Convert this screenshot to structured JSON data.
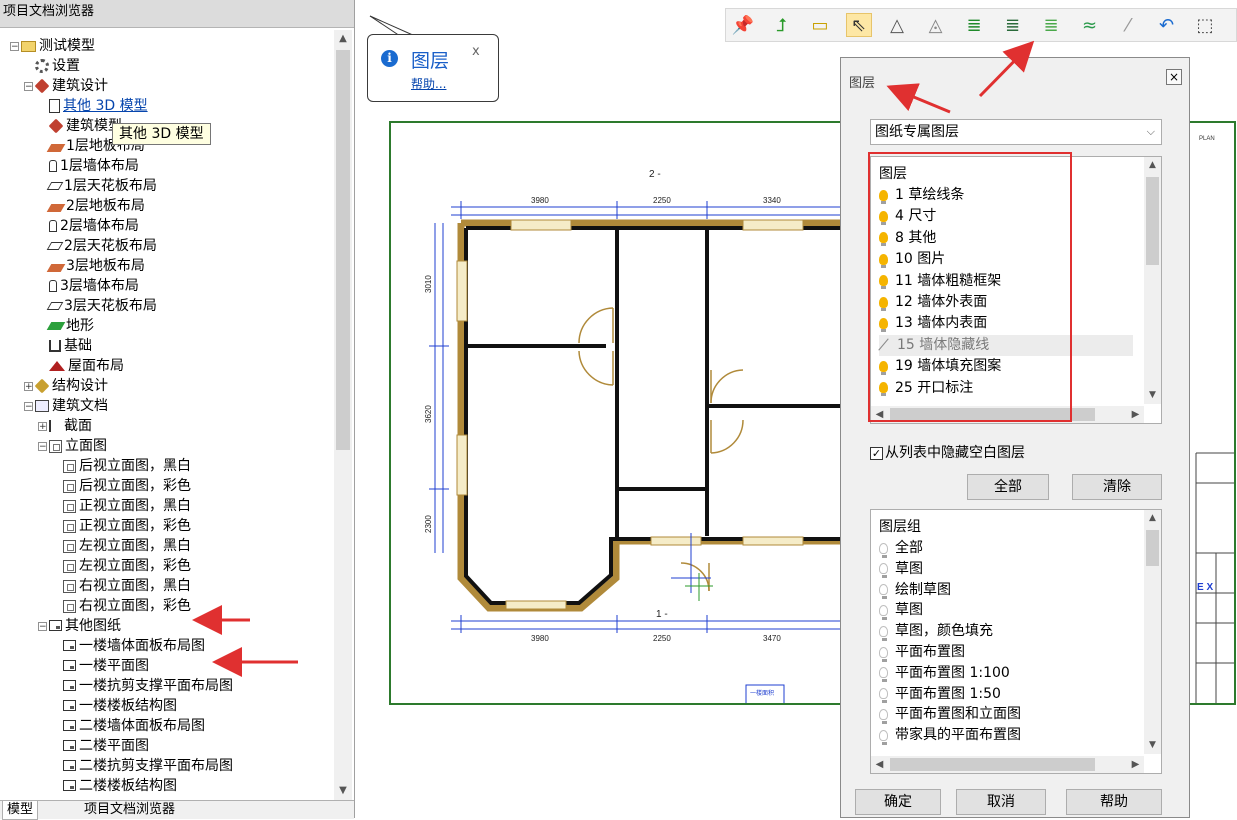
{
  "browser": {
    "title": "项目文档浏览器",
    "tooltip": "其他 3D 模型",
    "tree": [
      {
        "label": "测试模型",
        "icon": "folder-icon",
        "exp": "−"
      },
      {
        "label": "设置",
        "icon": "gear-icon"
      },
      {
        "label": "建筑设计",
        "icon": "architecture-icon",
        "exp": "−"
      },
      {
        "label": "其他 3D 模型",
        "icon": "3d-model-doc-icon",
        "link": true
      },
      {
        "label": "建筑模型",
        "icon": "architecture-model-icon"
      },
      {
        "label": "1层地板布局",
        "icon": "slab-icon"
      },
      {
        "label": "1层墙体布局",
        "icon": "wall-icon"
      },
      {
        "label": "1层天花板布局",
        "icon": "ceiling-icon"
      },
      {
        "label": "2层地板布局",
        "icon": "slab-icon"
      },
      {
        "label": "2层墙体布局",
        "icon": "wall-icon"
      },
      {
        "label": "2层天花板布局",
        "icon": "ceiling-icon"
      },
      {
        "label": "3层地板布局",
        "icon": "slab-icon"
      },
      {
        "label": "3层墙体布局",
        "icon": "wall-icon"
      },
      {
        "label": "3层天花板布局",
        "icon": "ceiling-icon"
      },
      {
        "label": "地形",
        "icon": "terrain-icon"
      },
      {
        "label": "基础",
        "icon": "foundation-icon"
      },
      {
        "label": "屋面布局",
        "icon": "roof-icon"
      },
      {
        "label": "结构设计",
        "icon": "structure-icon",
        "exp": "+"
      },
      {
        "label": "建筑文档",
        "icon": "documents-icon",
        "exp": "−"
      },
      {
        "label": "截面",
        "icon": "section-icon",
        "exp": "+"
      },
      {
        "label": "立面图",
        "icon": "elevation-icon",
        "exp": "−"
      },
      {
        "label": "后视立面图，黑白",
        "icon": "elevation-icon"
      },
      {
        "label": "后视立面图，彩色",
        "icon": "elevation-icon"
      },
      {
        "label": "正视立面图，黑白",
        "icon": "elevation-icon"
      },
      {
        "label": "正视立面图，彩色",
        "icon": "elevation-icon"
      },
      {
        "label": "左视立面图，黑白",
        "icon": "elevation-icon"
      },
      {
        "label": "左视立面图，彩色",
        "icon": "elevation-icon"
      },
      {
        "label": "右视立面图，黑白",
        "icon": "elevation-icon"
      },
      {
        "label": "右视立面图，彩色",
        "icon": "elevation-icon"
      },
      {
        "label": "其他图纸",
        "icon": "sheet-icon",
        "exp": "−"
      },
      {
        "label": "一楼墙体面板布局图",
        "icon": "sheet-icon"
      },
      {
        "label": "一楼平面图",
        "icon": "sheet-icon"
      },
      {
        "label": "一楼抗剪支撑平面布局图",
        "icon": "sheet-icon"
      },
      {
        "label": "一楼楼板结构图",
        "icon": "sheet-icon"
      },
      {
        "label": "二楼墙体面板布局图",
        "icon": "sheet-icon"
      },
      {
        "label": "二楼平面图",
        "icon": "sheet-icon"
      },
      {
        "label": "二楼抗剪支撑平面布局图",
        "icon": "sheet-icon"
      },
      {
        "label": "二楼楼板结构图",
        "icon": "sheet-icon"
      }
    ],
    "tabs": [
      "模型",
      "项目文档浏览器"
    ]
  },
  "toolbar": {
    "tools": [
      "pin-icon",
      "smart-tool-icon",
      "ruler-icon",
      "select-arrow-icon",
      "triangle-icon",
      "dashed-triangle-icon",
      "layers-green-icon",
      "layers-dark-icon",
      "layers-stack-icon",
      "layers-thin-icon",
      "line-icon",
      "undo-arrow-icon",
      "frame-icon"
    ],
    "selected_index": 3
  },
  "helpbox": {
    "title": "图层",
    "close": "x",
    "help": "帮助..."
  },
  "plan": {
    "dims_top": [
      "3980",
      "2250",
      "3340"
    ],
    "dims_bottom": [
      "3980",
      "2250",
      "3470"
    ],
    "dims_left": [
      "3010",
      "3620",
      "2300"
    ],
    "marker_top": "2 -",
    "marker_bottom": "1 -",
    "stamp": "一楼面积"
  },
  "dialog": {
    "title": "图层",
    "close": "×",
    "scope": "图纸专属图层",
    "layers_header": "图层",
    "layers": [
      {
        "label": "1 草绘线条",
        "state": "on"
      },
      {
        "label": "4 尺寸",
        "state": "on"
      },
      {
        "label": "8 其他",
        "state": "on"
      },
      {
        "label": "10 图片",
        "state": "on"
      },
      {
        "label": "11 墙体粗糙框架",
        "state": "on"
      },
      {
        "label": "12 墙体外表面",
        "state": "on"
      },
      {
        "label": "13 墙体内表面",
        "state": "on"
      },
      {
        "label": "15 墙体隐藏线",
        "state": "hidden"
      },
      {
        "label": "19 墙体填充图案",
        "state": "on"
      },
      {
        "label": "25 开口标注",
        "state": "on"
      }
    ],
    "hide_empty_label": "从列表中隐藏空白图层",
    "hide_empty_checked": "✓",
    "all_button": "全部",
    "clear_button": "清除",
    "groups_header": "图层组",
    "groups": [
      "全部",
      "草图",
      "绘制草图",
      "草图",
      "草图，颜色填充",
      "平面布置图",
      "平面布置图 1:100",
      "平面布置图 1:50",
      "平面布置图和立面图",
      "带家具的平面布置图"
    ],
    "ok_button": "确定",
    "cancel_button": "取消",
    "help_button": "帮助"
  },
  "colors": {
    "accent_red": "#e03030",
    "sheet_border": "#2d7a2d",
    "dim_blue": "#1f3fd0",
    "wall_gold": "#b08a3a"
  }
}
